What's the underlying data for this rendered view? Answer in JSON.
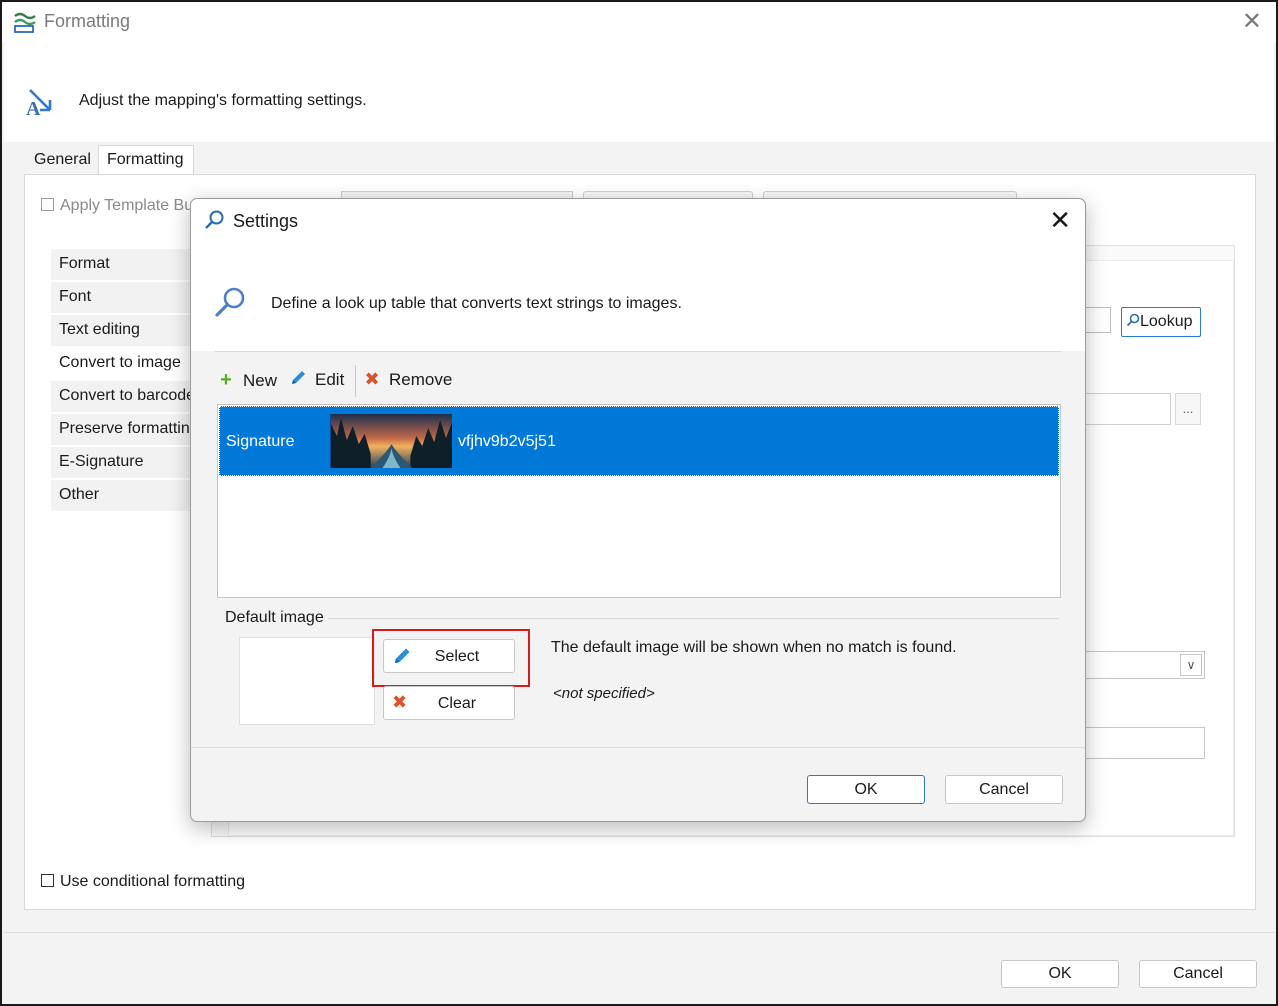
{
  "window": {
    "title": "Formatting",
    "header_text": "Adjust the mapping's formatting settings."
  },
  "tabs": [
    {
      "label": "General"
    },
    {
      "label": "Formatting"
    }
  ],
  "panel": {
    "apply_template_label": "Apply Template Bu",
    "nav_items": [
      {
        "label": "Format"
      },
      {
        "label": "Font"
      },
      {
        "label": "Text editing"
      },
      {
        "label": "Convert to image"
      },
      {
        "label": "Convert to barcode"
      },
      {
        "label": "Preserve formatting"
      },
      {
        "label": "E-Signature"
      },
      {
        "label": "Other"
      }
    ],
    "lookup_label": "Lookup",
    "ellipsis_label": "...",
    "dropdown_chevron": "∨",
    "use_conditional_label": "Use conditional formatting"
  },
  "footer": {
    "ok_label": "OK",
    "cancel_label": "Cancel"
  },
  "dialog": {
    "title": "Settings",
    "close_glyph": "✕",
    "header_text": "Define a look up table that converts text strings to images.",
    "toolbar": {
      "new_label": "New",
      "edit_label": "Edit",
      "remove_label": "Remove"
    },
    "rows": [
      {
        "key": "Signature",
        "value": "vfjhv9b2v5j51"
      }
    ],
    "default_image": {
      "group_label": "Default image",
      "select_label": "Select",
      "clear_label": "Clear",
      "description": "The default image will be shown when no match is found.",
      "value": "<not specified>"
    },
    "ok_label": "OK",
    "cancel_label": "Cancel"
  },
  "colors": {
    "selection": "#0078d7",
    "accent_border": "#2b79d1",
    "highlight": "#d81c1c",
    "add_green": "#5bab2c",
    "remove_red": "#d8542b"
  }
}
